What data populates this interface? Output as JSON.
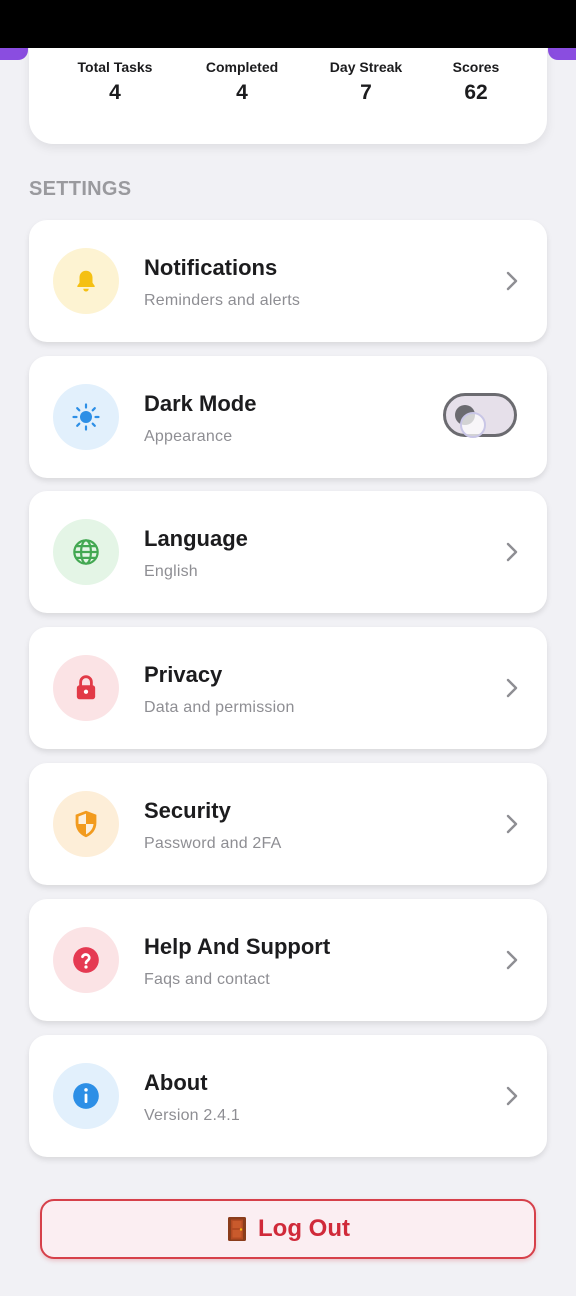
{
  "stats": [
    {
      "label": "Total Tasks",
      "value": "4"
    },
    {
      "label": "Completed",
      "value": "4"
    },
    {
      "label": "Day Streak",
      "value": "7"
    },
    {
      "label": "Scores",
      "value": "62"
    }
  ],
  "settings": {
    "section_title": "SETTINGS",
    "items": [
      {
        "title": "Notifications",
        "subtitle": "Reminders and alerts",
        "icon": "bell-icon",
        "icon_bg": "#fdf3d2",
        "icon_color": "#f5c013",
        "control": "chevron"
      },
      {
        "title": "Dark Mode",
        "subtitle": "Appearance",
        "icon": "sun-icon",
        "icon_bg": "#e2f0fc",
        "icon_color": "#2d8fe6",
        "control": "toggle",
        "toggle_on": false
      },
      {
        "title": "Language",
        "subtitle": "English",
        "icon": "globe-icon",
        "icon_bg": "#e4f5e6",
        "icon_color": "#43a852",
        "control": "chevron"
      },
      {
        "title": "Privacy",
        "subtitle": "Data and permission",
        "icon": "lock-icon",
        "icon_bg": "#fbe3e5",
        "icon_color": "#e23a47",
        "control": "chevron"
      },
      {
        "title": "Security",
        "subtitle": "Password and 2FA",
        "icon": "shield-icon",
        "icon_bg": "#fdeed8",
        "icon_color": "#f29b1e",
        "control": "chevron"
      },
      {
        "title": "Help And Support",
        "subtitle": "Faqs and contact",
        "icon": "help-icon",
        "icon_bg": "#fbe3e5",
        "icon_color": "#e53a52",
        "control": "chevron"
      },
      {
        "title": "About",
        "subtitle": "Version 2.4.1",
        "icon": "info-icon",
        "icon_bg": "#e2f0fc",
        "icon_color": "#2d8fe6",
        "control": "chevron"
      }
    ]
  },
  "logout": {
    "label": "Log Out",
    "icon": "door-icon",
    "color": "#d02a3a"
  }
}
